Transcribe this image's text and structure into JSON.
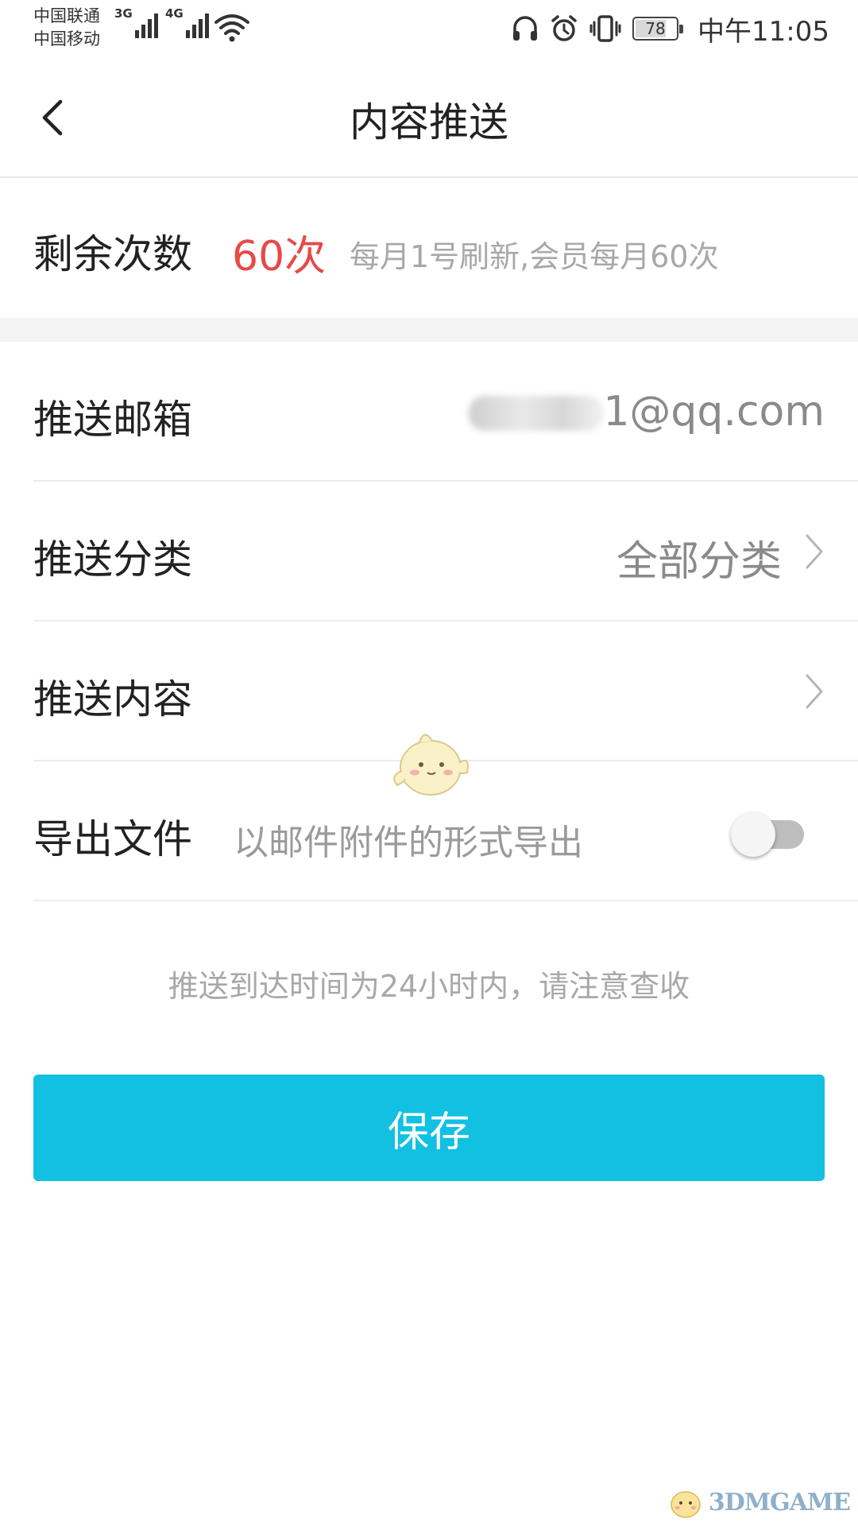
{
  "status_bar": {
    "carrier_1": "中国联通",
    "carrier_2": "中国移动",
    "network_1": "3G",
    "network_2": "4G",
    "battery_level": "78",
    "battery_fraction": 0.78,
    "time": "中午11:05",
    "icons": [
      "signal-icon",
      "wifi-icon",
      "headphone-icon",
      "alarm-icon",
      "vibrate-icon",
      "battery-icon"
    ]
  },
  "header": {
    "title": "内容推送",
    "back_icon": "chevron-left-icon"
  },
  "remaining": {
    "label": "剩余次数",
    "value": "60次",
    "note": "每月1号刷新,会员每月60次",
    "value_color": "#e84848"
  },
  "settings": {
    "email": {
      "label": "推送邮箱",
      "value": "1@qq.com"
    },
    "category": {
      "label": "推送分类",
      "value": "全部分类"
    },
    "content": {
      "label": "推送内容"
    },
    "export": {
      "label": "导出文件",
      "description": "以邮件附件的形式导出",
      "enabled": false
    }
  },
  "notice": "推送到达时间为24小时内，请注意查收",
  "save_button": {
    "label": "保存",
    "color": "#12c0e2"
  },
  "watermark": {
    "text": "3DMGAME"
  }
}
